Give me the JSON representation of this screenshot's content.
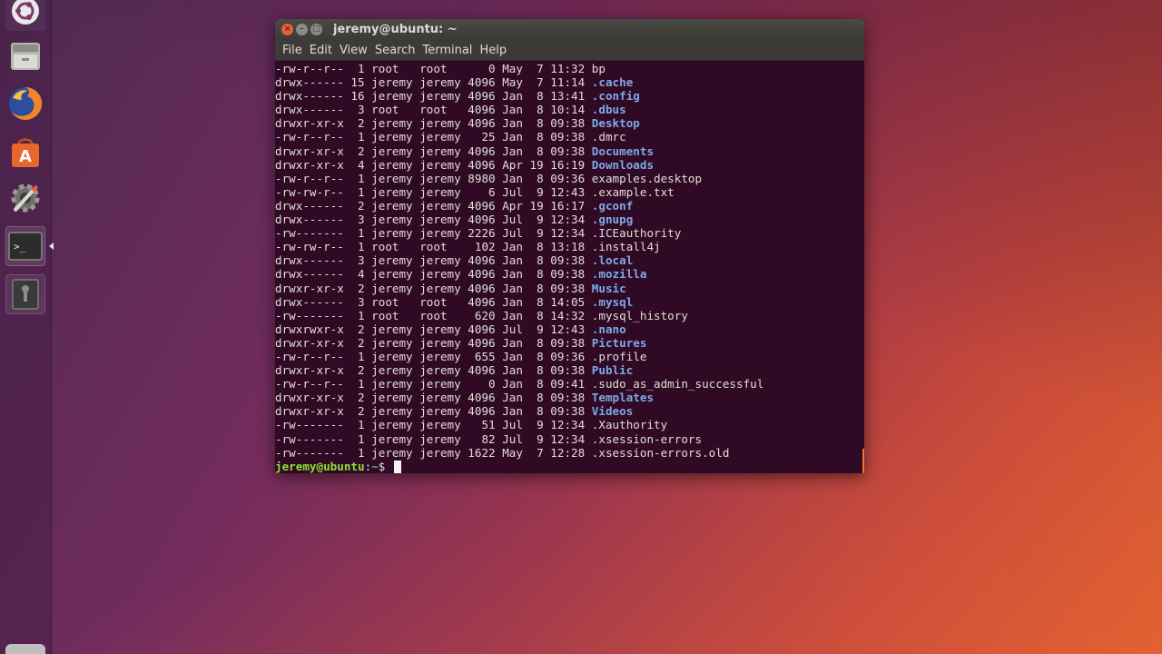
{
  "window": {
    "title": "jeremy@ubuntu: ~",
    "menu": [
      "File",
      "Edit",
      "View",
      "Search",
      "Terminal",
      "Help"
    ]
  },
  "launcher": {
    "items": [
      {
        "icon": "ubuntu-dash-icon"
      },
      {
        "icon": "files-icon"
      },
      {
        "icon": "firefox-icon"
      },
      {
        "icon": "software-center-icon"
      },
      {
        "icon": "system-settings-icon"
      },
      {
        "icon": "terminal-icon"
      },
      {
        "icon": "drive-icon"
      }
    ]
  },
  "listing": [
    {
      "perm": "-rw-r--r--",
      "links": "1",
      "owner": "root",
      "group": "root",
      "size": "0",
      "month": "May",
      "day": "7",
      "time": "11:32",
      "name": "bp",
      "dir": false
    },
    {
      "perm": "drwx------",
      "links": "15",
      "owner": "jeremy",
      "group": "jeremy",
      "size": "4096",
      "month": "May",
      "day": "7",
      "time": "11:14",
      "name": ".cache",
      "dir": true
    },
    {
      "perm": "drwx------",
      "links": "16",
      "owner": "jeremy",
      "group": "jeremy",
      "size": "4096",
      "month": "Jan",
      "day": "8",
      "time": "13:41",
      "name": ".config",
      "dir": true
    },
    {
      "perm": "drwx------",
      "links": "3",
      "owner": "root",
      "group": "root",
      "size": "4096",
      "month": "Jan",
      "day": "8",
      "time": "10:14",
      "name": ".dbus",
      "dir": true
    },
    {
      "perm": "drwxr-xr-x",
      "links": "2",
      "owner": "jeremy",
      "group": "jeremy",
      "size": "4096",
      "month": "Jan",
      "day": "8",
      "time": "09:38",
      "name": "Desktop",
      "dir": true
    },
    {
      "perm": "-rw-r--r--",
      "links": "1",
      "owner": "jeremy",
      "group": "jeremy",
      "size": "25",
      "month": "Jan",
      "day": "8",
      "time": "09:38",
      "name": ".dmrc",
      "dir": false
    },
    {
      "perm": "drwxr-xr-x",
      "links": "2",
      "owner": "jeremy",
      "group": "jeremy",
      "size": "4096",
      "month": "Jan",
      "day": "8",
      "time": "09:38",
      "name": "Documents",
      "dir": true
    },
    {
      "perm": "drwxr-xr-x",
      "links": "4",
      "owner": "jeremy",
      "group": "jeremy",
      "size": "4096",
      "month": "Apr",
      "day": "19",
      "time": "16:19",
      "name": "Downloads",
      "dir": true
    },
    {
      "perm": "-rw-r--r--",
      "links": "1",
      "owner": "jeremy",
      "group": "jeremy",
      "size": "8980",
      "month": "Jan",
      "day": "8",
      "time": "09:36",
      "name": "examples.desktop",
      "dir": false
    },
    {
      "perm": "-rw-rw-r--",
      "links": "1",
      "owner": "jeremy",
      "group": "jeremy",
      "size": "6",
      "month": "Jul",
      "day": "9",
      "time": "12:43",
      "name": ".example.txt",
      "dir": false
    },
    {
      "perm": "drwx------",
      "links": "2",
      "owner": "jeremy",
      "group": "jeremy",
      "size": "4096",
      "month": "Apr",
      "day": "19",
      "time": "16:17",
      "name": ".gconf",
      "dir": true
    },
    {
      "perm": "drwx------",
      "links": "3",
      "owner": "jeremy",
      "group": "jeremy",
      "size": "4096",
      "month": "Jul",
      "day": "9",
      "time": "12:34",
      "name": ".gnupg",
      "dir": true
    },
    {
      "perm": "-rw-------",
      "links": "1",
      "owner": "jeremy",
      "group": "jeremy",
      "size": "2226",
      "month": "Jul",
      "day": "9",
      "time": "12:34",
      "name": ".ICEauthority",
      "dir": false
    },
    {
      "perm": "-rw-rw-r--",
      "links": "1",
      "owner": "root",
      "group": "root",
      "size": "102",
      "month": "Jan",
      "day": "8",
      "time": "13:18",
      "name": ".install4j",
      "dir": false
    },
    {
      "perm": "drwx------",
      "links": "3",
      "owner": "jeremy",
      "group": "jeremy",
      "size": "4096",
      "month": "Jan",
      "day": "8",
      "time": "09:38",
      "name": ".local",
      "dir": true
    },
    {
      "perm": "drwx------",
      "links": "4",
      "owner": "jeremy",
      "group": "jeremy",
      "size": "4096",
      "month": "Jan",
      "day": "8",
      "time": "09:38",
      "name": ".mozilla",
      "dir": true
    },
    {
      "perm": "drwxr-xr-x",
      "links": "2",
      "owner": "jeremy",
      "group": "jeremy",
      "size": "4096",
      "month": "Jan",
      "day": "8",
      "time": "09:38",
      "name": "Music",
      "dir": true
    },
    {
      "perm": "drwx------",
      "links": "3",
      "owner": "root",
      "group": "root",
      "size": "4096",
      "month": "Jan",
      "day": "8",
      "time": "14:05",
      "name": ".mysql",
      "dir": true
    },
    {
      "perm": "-rw-------",
      "links": "1",
      "owner": "root",
      "group": "root",
      "size": "620",
      "month": "Jan",
      "day": "8",
      "time": "14:32",
      "name": ".mysql_history",
      "dir": false
    },
    {
      "perm": "drwxrwxr-x",
      "links": "2",
      "owner": "jeremy",
      "group": "jeremy",
      "size": "4096",
      "month": "Jul",
      "day": "9",
      "time": "12:43",
      "name": ".nano",
      "dir": true
    },
    {
      "perm": "drwxr-xr-x",
      "links": "2",
      "owner": "jeremy",
      "group": "jeremy",
      "size": "4096",
      "month": "Jan",
      "day": "8",
      "time": "09:38",
      "name": "Pictures",
      "dir": true
    },
    {
      "perm": "-rw-r--r--",
      "links": "1",
      "owner": "jeremy",
      "group": "jeremy",
      "size": "655",
      "month": "Jan",
      "day": "8",
      "time": "09:36",
      "name": ".profile",
      "dir": false
    },
    {
      "perm": "drwxr-xr-x",
      "links": "2",
      "owner": "jeremy",
      "group": "jeremy",
      "size": "4096",
      "month": "Jan",
      "day": "8",
      "time": "09:38",
      "name": "Public",
      "dir": true
    },
    {
      "perm": "-rw-r--r--",
      "links": "1",
      "owner": "jeremy",
      "group": "jeremy",
      "size": "0",
      "month": "Jan",
      "day": "8",
      "time": "09:41",
      "name": ".sudo_as_admin_successful",
      "dir": false
    },
    {
      "perm": "drwxr-xr-x",
      "links": "2",
      "owner": "jeremy",
      "group": "jeremy",
      "size": "4096",
      "month": "Jan",
      "day": "8",
      "time": "09:38",
      "name": "Templates",
      "dir": true
    },
    {
      "perm": "drwxr-xr-x",
      "links": "2",
      "owner": "jeremy",
      "group": "jeremy",
      "size": "4096",
      "month": "Jan",
      "day": "8",
      "time": "09:38",
      "name": "Videos",
      "dir": true
    },
    {
      "perm": "-rw-------",
      "links": "1",
      "owner": "jeremy",
      "group": "jeremy",
      "size": "51",
      "month": "Jul",
      "day": "9",
      "time": "12:34",
      "name": ".Xauthority",
      "dir": false
    },
    {
      "perm": "-rw-------",
      "links": "1",
      "owner": "jeremy",
      "group": "jeremy",
      "size": "82",
      "month": "Jul",
      "day": "9",
      "time": "12:34",
      "name": ".xsession-errors",
      "dir": false
    },
    {
      "perm": "-rw-------",
      "links": "1",
      "owner": "jeremy",
      "group": "jeremy",
      "size": "1622",
      "month": "May",
      "day": "7",
      "time": "12:28",
      "name": ".xsession-errors.old",
      "dir": false
    }
  ],
  "prompt": {
    "user": "jeremy@ubuntu",
    "sep": ":",
    "path": "~",
    "symbol": "$ "
  },
  "colors": {
    "terminal_bg": "#300a24",
    "directory": "#7fa8e8",
    "prompt_user": "#8ae234",
    "prompt_path": "#729fcf"
  }
}
